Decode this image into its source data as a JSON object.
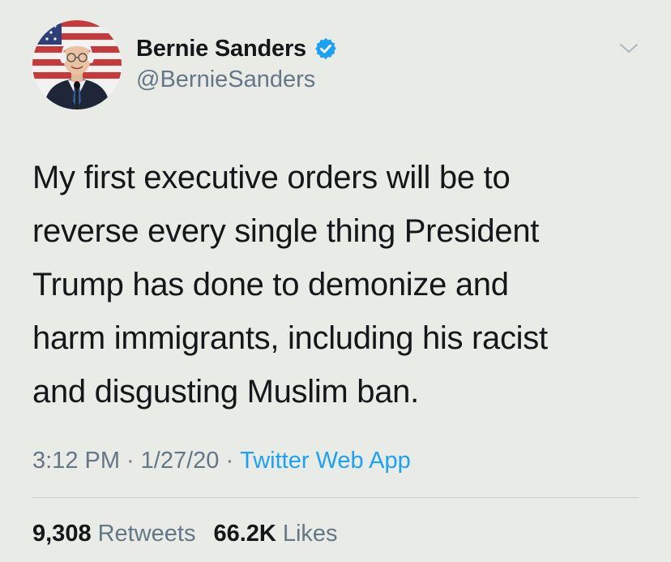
{
  "author": {
    "name": "Bernie Sanders",
    "handle": "@BernieSanders",
    "verified": true,
    "verified_color": "#1da1f2"
  },
  "tweet": {
    "text": "My first executive orders will be to\nreverse every single thing President\nTrump has done to demonize and\nharm immigrants, including his racist\nand disgusting Muslim ban."
  },
  "meta": {
    "time": "3:12 PM",
    "separator": "·",
    "date": "1/27/20",
    "source": "Twitter Web App"
  },
  "stats": {
    "retweets_count": "9,308",
    "retweets_label": "Retweets",
    "likes_count": "66.2K",
    "likes_label": "Likes"
  },
  "icons": {
    "verified": "verified-badge-icon",
    "menu": "chevron-down-icon"
  },
  "colors": {
    "background": "#e9ebe6",
    "text_primary": "#14171a",
    "text_secondary": "#657786",
    "link": "#1da1f2"
  }
}
